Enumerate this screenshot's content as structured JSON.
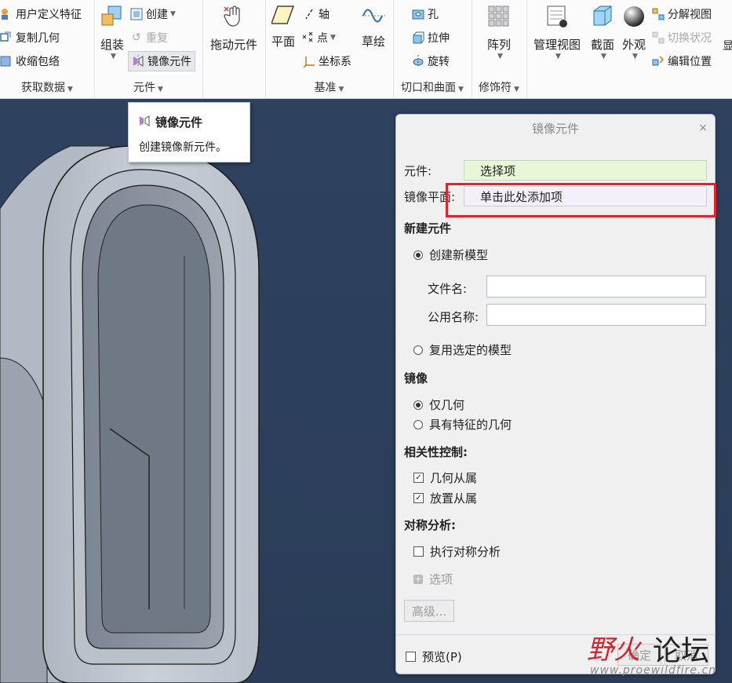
{
  "ribbon": {
    "get_data": {
      "items": [
        "用户定义特征",
        "复制几何",
        "收缩包络"
      ],
      "label": "获取数据"
    },
    "component": {
      "assemble": "组装",
      "create": "创建",
      "repeat": "重复",
      "mirror_component": "镜像元件",
      "drag": "拖动元件",
      "label": "元件"
    },
    "datum": {
      "plane": "平面",
      "axis": "轴",
      "point": "点",
      "csys": "坐标系",
      "sketch": "草绘",
      "label": "基准"
    },
    "cut_surface": {
      "hole": "孔",
      "extrude": "拉伸",
      "revolve": "旋转",
      "label": "切口和曲面"
    },
    "modifier": {
      "pattern": "阵列",
      "label": "修饰符"
    },
    "model_display": {
      "manage_views": "管理视图",
      "section": "截面",
      "appearance": "外观",
      "explode_view": "分解视图",
      "toggle_status": "切换状况",
      "edit_position": "编辑位置",
      "cut_off": "显"
    }
  },
  "tooltip": {
    "title": "镜像元件",
    "description": "创建镜像新元件。"
  },
  "dialog": {
    "title": "镜像元件",
    "close": "×",
    "component_label": "元件:",
    "component_value": "选择项",
    "mirror_plane_label": "镜像平面:",
    "mirror_plane_value": "单击此处添加项",
    "new_component_heading": "新建元件",
    "create_new_model": "创建新模型",
    "file_name_label": "文件名:",
    "common_name_label": "公用名称:",
    "reuse_selected_model": "复用选定的模型",
    "mirror_heading": "镜像",
    "geometry_only": "仅几何",
    "with_features": "具有特征的几何",
    "dependency_heading": "相关性控制:",
    "geometry_dependent": "几何从属",
    "placement_dependent": "放置从属",
    "symmetry_heading": "对称分析:",
    "run_symmetry": "执行对称分析",
    "options": "选项",
    "advanced": "高级...",
    "preview": "预览(P)",
    "ok": "确定",
    "cancel": "取消"
  },
  "watermark": {
    "brand1": "野火",
    "brand2": "论坛",
    "url": "www.proewildfire.cn"
  },
  "colors": {
    "background": "#2b3d57",
    "highlight": "#e8202a",
    "collector_green": "#e8f7d6",
    "collector_pink": "#f5eff7"
  }
}
